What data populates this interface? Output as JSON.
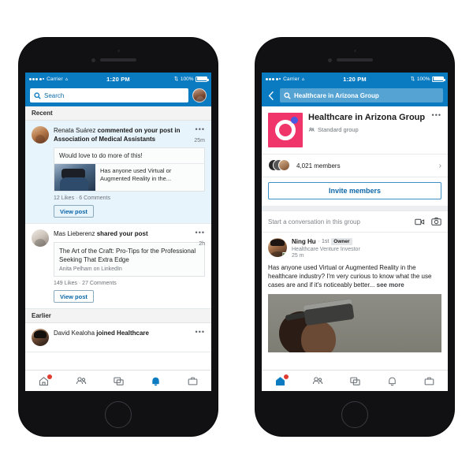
{
  "phone_left": {
    "status_bar": {
      "carrier": "Carrier",
      "time": "1:20 PM",
      "battery": "100%"
    },
    "search": {
      "placeholder": "Search",
      "icon": "search-icon"
    },
    "sections": [
      {
        "header": "Recent",
        "items": [
          {
            "actor": "Renata Suárez",
            "action": "commented on your post in Association of Medical Assistants",
            "time": "25m",
            "more": "•••",
            "preview": {
              "quote": "Would love to do more of this!",
              "text": "Has anyone used Virtual or Augmented Reality in the..."
            },
            "meta": "12 Likes  ·  6 Comments",
            "cta": "View post"
          },
          {
            "actor": "Mas Lieberenz",
            "action": "shared your post",
            "time": "2h",
            "more": "•••",
            "article": {
              "title": "The Art of the Craft: Pro-Tips for the Professional Seeking That Extra Edge",
              "source": "Anita Pelham on LinkedIn"
            },
            "meta": "149 Likes  ·  27 Comments",
            "cta": "View post"
          }
        ]
      },
      {
        "header": "Earlier",
        "items": [
          {
            "actor": "David Kealoha",
            "action": "joined Healthcare",
            "time": "",
            "more": "•••"
          }
        ]
      }
    ],
    "tabs": [
      {
        "name": "home",
        "label": "Home",
        "active": false,
        "badge": true
      },
      {
        "name": "network",
        "label": "My Network",
        "active": false,
        "badge": false
      },
      {
        "name": "messaging",
        "label": "Messaging",
        "active": false,
        "badge": false
      },
      {
        "name": "notifications",
        "label": "Notifications",
        "active": true,
        "badge": false
      },
      {
        "name": "jobs",
        "label": "Jobs",
        "active": false,
        "badge": false
      }
    ]
  },
  "phone_right": {
    "status_bar": {
      "carrier": "Carrier",
      "time": "1:20 PM",
      "battery": "100%"
    },
    "search": {
      "value": "Healthcare in Arizona Group",
      "icon": "search-icon",
      "back": "back-chevron-icon"
    },
    "group": {
      "name": "Healthcare in Arizona Group",
      "type": "Standard group",
      "more": "•••",
      "members_count": "4,021 members",
      "members_chevron": "›",
      "invite_label": "Invite members"
    },
    "composer": {
      "placeholder": "Start a conversation in this group",
      "video_icon": "video-camera-icon",
      "photo_icon": "camera-icon"
    },
    "post": {
      "author": "Ning Hu",
      "degree": "· 1st",
      "badge": "Owner",
      "headline": "Healthcare Venture Investor",
      "time": "25 m",
      "body": "Has anyone used Virtual or Augmented Reality in the healthcare industry? I'm very curious to know what the use cases are and if it's noticeably better...",
      "see_more": "see more"
    },
    "tabs": [
      {
        "name": "home",
        "label": "Home",
        "active": true,
        "badge": true
      },
      {
        "name": "network",
        "label": "My Network",
        "active": false,
        "badge": false
      },
      {
        "name": "messaging",
        "label": "Messaging",
        "active": false,
        "badge": false
      },
      {
        "name": "notifications",
        "label": "Notifications",
        "active": false,
        "badge": false
      },
      {
        "name": "jobs",
        "label": "Jobs",
        "active": false,
        "badge": false
      }
    ]
  },
  "colors": {
    "brand_blue": "#0b7bc1",
    "link_blue": "#0a66a8",
    "unread_bg": "#e8f4fb",
    "badge_red": "#e03b2f",
    "group_logo_pink": "#f0356b",
    "group_logo_dot": "#4a5ae0",
    "page_bg": "#ffffff"
  }
}
